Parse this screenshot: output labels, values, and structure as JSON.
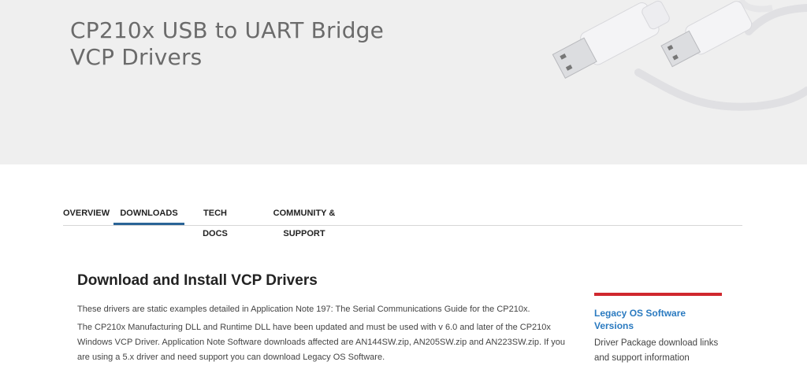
{
  "hero": {
    "title_line1": "CP210x USB to UART Bridge",
    "title_line2": "VCP Drivers",
    "image": "usb-cables-image"
  },
  "tabs": [
    {
      "label": "OVERVIEW",
      "active": false
    },
    {
      "label": "DOWNLOADS",
      "active": true
    },
    {
      "label": "TECH DOCS",
      "active": false
    },
    {
      "label": "COMMUNITY & SUPPORT",
      "active": false
    }
  ],
  "main": {
    "heading": "Download and Install VCP Drivers",
    "paragraph1": "These drivers are static examples detailed in Application Note 197: The Serial Communications Guide for the CP210x.",
    "paragraph2": "The CP210x Manufacturing DLL and Runtime DLL have been updated and must be used with v 6.0 and later of the CP210x Windows VCP Driver. Application Note Software downloads affected are AN144SW.zip, AN205SW.zip and AN223SW.zip. If you are using a 5.x driver and need support you can download Legacy OS Software."
  },
  "sidebar": {
    "link_label": "Legacy OS Software Versions",
    "description": "Driver Package download links and support information"
  },
  "colors": {
    "hero_bg": "#efefef",
    "active_tab_underline": "#2a6496",
    "sidebar_accent": "#d0282e",
    "link": "#2a7ac0"
  }
}
